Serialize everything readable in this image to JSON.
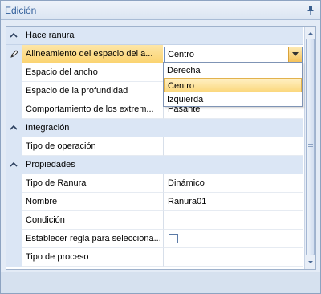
{
  "panel": {
    "title": "Edición"
  },
  "categories": {
    "hace_ranura": "Hace ranura",
    "integracion": "Integración",
    "propiedades": "Propiedades"
  },
  "hace_ranura": {
    "alineamiento": {
      "name": "Alineamiento del espacio del a...",
      "value": "Centro"
    },
    "espacio_ancho": {
      "name": "Espacio del ancho",
      "value": ""
    },
    "espacio_profundidad": {
      "name": "Espacio de la profundidad",
      "value": ""
    },
    "comportamiento": {
      "name": "Comportamiento de los extrem...",
      "value": "Pasante"
    }
  },
  "integracion": {
    "tipo_operacion": {
      "name": "Tipo de operación",
      "value": ""
    }
  },
  "propiedades": {
    "tipo_ranura": {
      "name": "Tipo de Ranura",
      "value": "Dinámico"
    },
    "nombre": {
      "name": "Nombre",
      "value": "Ranura01"
    },
    "condicion": {
      "name": "Condición",
      "value": ""
    },
    "regla": {
      "name": "Establecer regla para selecciona...",
      "checked": false
    },
    "tipo_proceso": {
      "name": "Tipo de proceso",
      "value": ""
    }
  },
  "dropdown": {
    "options": [
      "Derecha",
      "Centro",
      "Izquierda"
    ],
    "highlighted": "Centro"
  },
  "colors": {
    "accent": "#2f5d9a",
    "selection": "#fbd471",
    "category_bg": "#dbe6f5"
  }
}
